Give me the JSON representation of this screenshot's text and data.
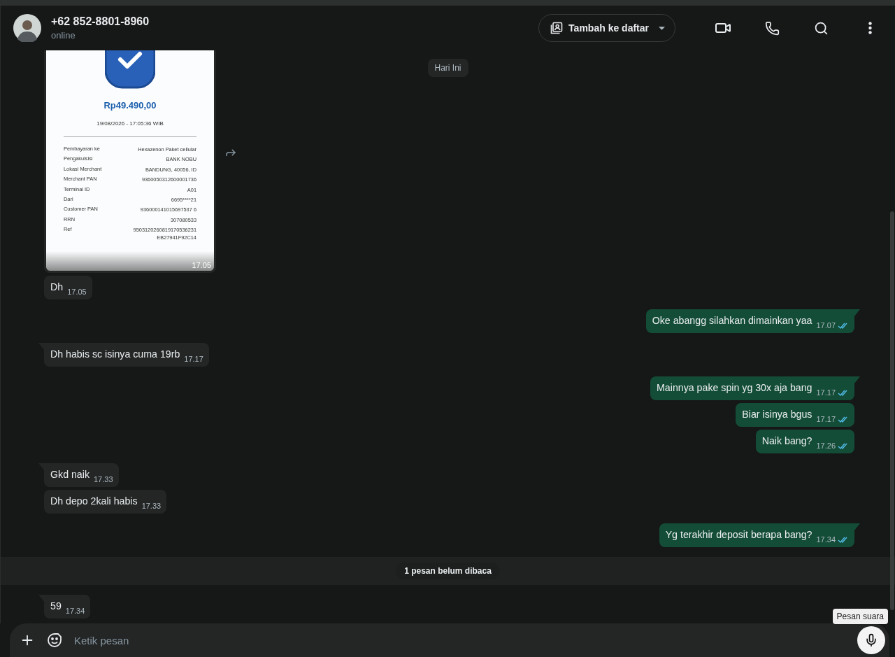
{
  "header": {
    "name": "+62 852-8801-8960",
    "status": "online",
    "list_button": "Tambah ke daftar"
  },
  "date_chip": "Hari Ini",
  "messages": [
    {
      "kind": "image",
      "time": "17.05",
      "receipt": {
        "amount": "Rp49.490,00",
        "datetime": "19/08/2026 - 17:05:36 WIB",
        "rows": [
          {
            "label": "Pembayaran ke",
            "value": "Hexazenon Paket cellular"
          },
          {
            "label": "Pengakuisisi",
            "value": "BANK NOBU"
          },
          {
            "label": "Lokasi Merchant",
            "value": "BANDUNG, 40056, ID"
          },
          {
            "label": "Merchant PAN",
            "value": "9360050312600001736"
          },
          {
            "label": "Terminal ID",
            "value": "A01"
          },
          {
            "label": "Dari",
            "value": "6695****21"
          },
          {
            "label": "Customer PAN",
            "value": "936000141015697537 6"
          },
          {
            "label": "RRN",
            "value": "307080533"
          },
          {
            "label": "Ref",
            "value": "9503120260819170536231\nEB27941F92C14"
          }
        ]
      }
    },
    {
      "kind": "received",
      "tail": false,
      "text": "Dh",
      "time": "17.05"
    },
    {
      "kind": "sent",
      "tail": true,
      "text": "Oke abangg silahkan dimainkan yaa",
      "time": "17.07",
      "read": true
    },
    {
      "kind": "received",
      "tail": true,
      "text": "Dh habis sc isinya cuma 19rb",
      "time": "17.17"
    },
    {
      "kind": "sent",
      "tail": true,
      "text": "Mainnya pake spin yg 30x aja bang",
      "time": "17.17",
      "read": true
    },
    {
      "kind": "sent",
      "tail": false,
      "text": "Biar isinya bgus",
      "time": "17.17",
      "read": true
    },
    {
      "kind": "sent",
      "tail": false,
      "text": "Naik bang?",
      "time": "17.26",
      "read": true
    },
    {
      "kind": "received",
      "tail": true,
      "text": "Gkd naik",
      "time": "17.33"
    },
    {
      "kind": "received",
      "tail": false,
      "text": "Dh depo 2kali habis",
      "time": "17.33"
    },
    {
      "kind": "sent",
      "tail": true,
      "text": "Yg terakhir deposit berapa bang?",
      "time": "17.34",
      "read": true
    },
    {
      "kind": "unread",
      "text": "1 pesan belum dibaca"
    },
    {
      "kind": "received",
      "tail": true,
      "text": "59",
      "time": "17.34"
    }
  ],
  "composer": {
    "placeholder": "Ketik pesan",
    "tooltip": "Pesan suara"
  }
}
